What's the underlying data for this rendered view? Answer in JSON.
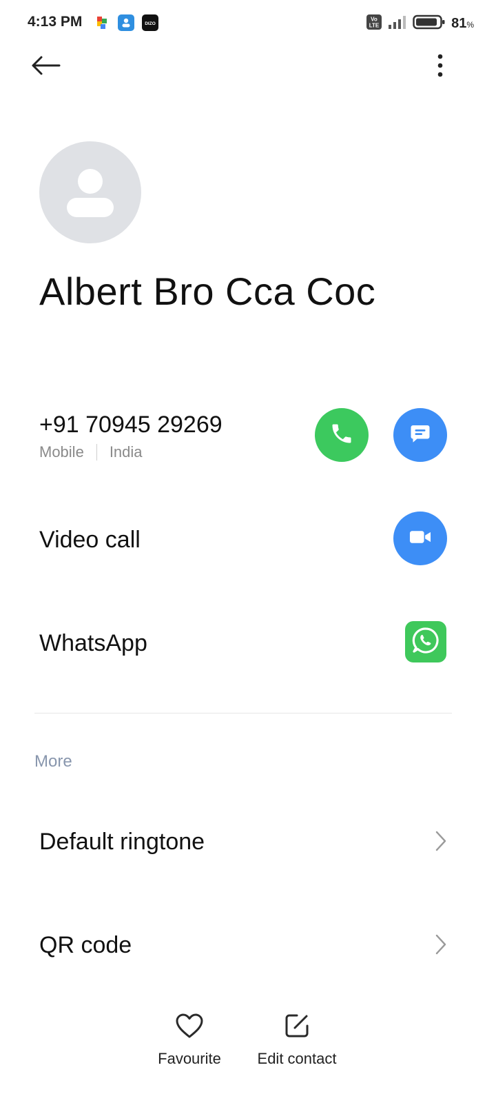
{
  "status_bar": {
    "time": "4:13 PM",
    "notification_icons": [
      "puzzle-icon",
      "contacts-app-icon",
      "dizo-app-icon"
    ],
    "dizo_label": "DIZO",
    "volte_label": "Vo LTE",
    "battery_percent": "81",
    "battery_unit": "%"
  },
  "contact": {
    "name": "Albert Bro Cca Coc",
    "phone": "+91 70945 29269",
    "phone_type": "Mobile",
    "phone_region": "India"
  },
  "actions": {
    "video_call_label": "Video call",
    "whatsapp_label": "WhatsApp"
  },
  "more": {
    "header": "More",
    "items": [
      {
        "label": "Default ringtone"
      },
      {
        "label": "QR code"
      }
    ]
  },
  "bottom_bar": {
    "favourite_label": "Favourite",
    "edit_label": "Edit contact"
  },
  "colors": {
    "call_green": "#3cc95e",
    "action_blue": "#3d8ef6",
    "whatsapp_green": "#3fc85b",
    "avatar_gray": "#dfe1e5",
    "section_header": "#8896ad"
  }
}
